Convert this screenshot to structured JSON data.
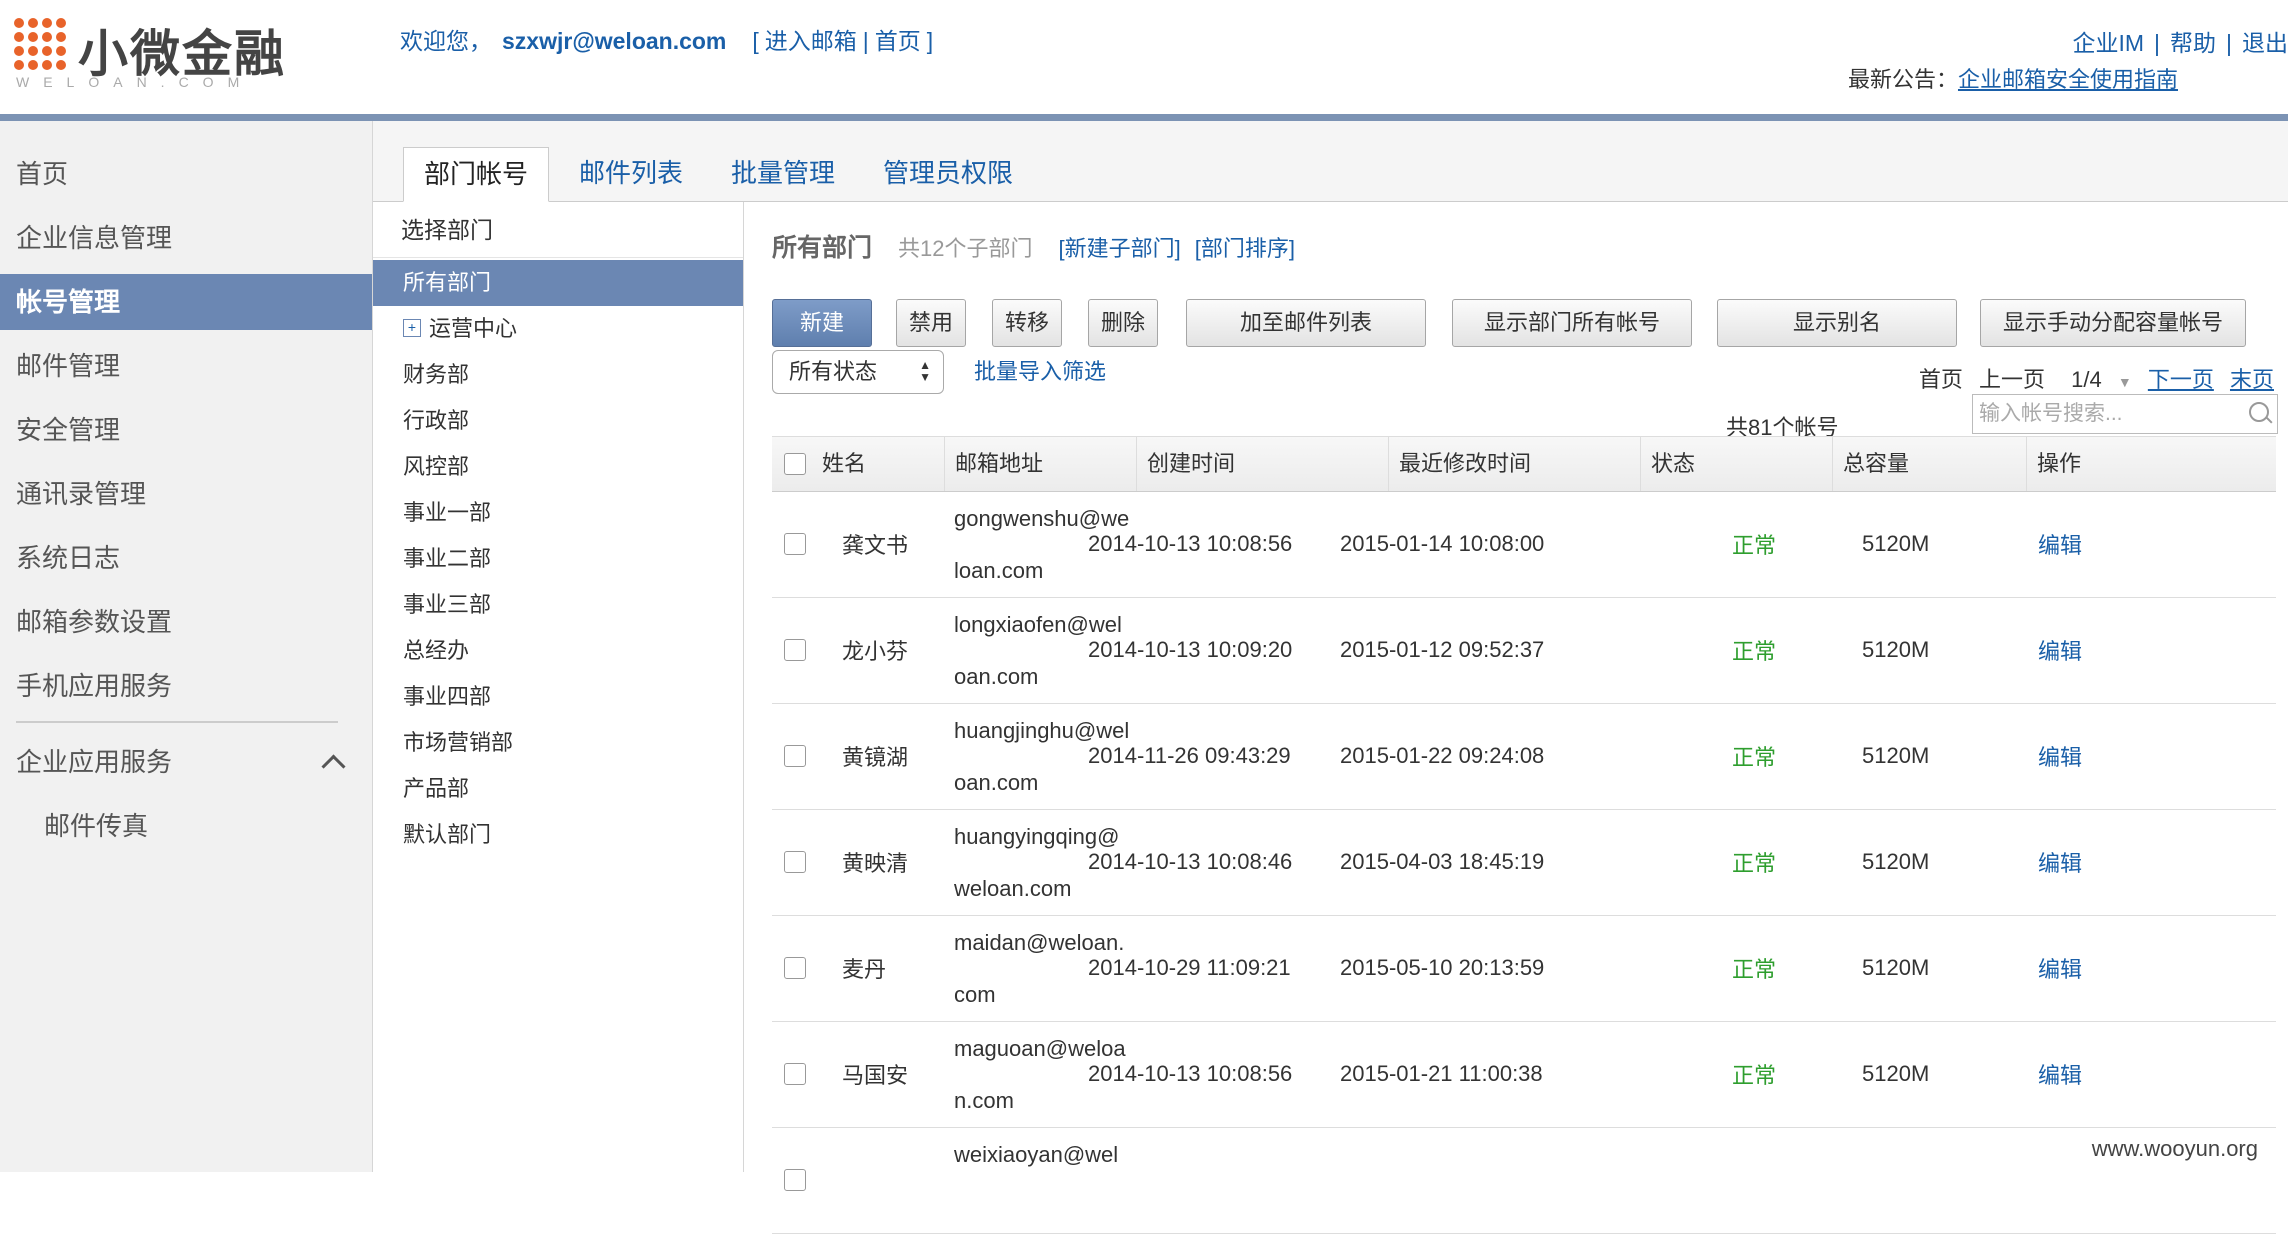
{
  "header": {
    "logo_text": "小微金融",
    "logo_sub": "WELOAN.COM",
    "welcome_prefix": "欢迎您，",
    "user_email": "szxwjr@weloan.com",
    "link_mailbox": "进入邮箱",
    "link_home": "首页",
    "top_links": {
      "im": "企业IM",
      "help": "帮助",
      "logout": "退出"
    },
    "notice_label": "最新公告：",
    "notice_link": "企业邮箱安全使用指南"
  },
  "sidebar": {
    "items": [
      {
        "label": "首页"
      },
      {
        "label": "企业信息管理"
      },
      {
        "label": "帐号管理"
      },
      {
        "label": "邮件管理"
      },
      {
        "label": "安全管理"
      },
      {
        "label": "通讯录管理"
      },
      {
        "label": "系统日志"
      },
      {
        "label": "邮箱参数设置"
      },
      {
        "label": "手机应用服务"
      }
    ],
    "group_label": "企业应用服务",
    "sub_items": [
      {
        "label": "邮件传真"
      }
    ]
  },
  "tabs": [
    {
      "label": "部门帐号"
    },
    {
      "label": "邮件列表"
    },
    {
      "label": "批量管理"
    },
    {
      "label": "管理员权限"
    }
  ],
  "departments": {
    "header": "选择部门",
    "items": [
      {
        "label": "所有部门"
      },
      {
        "label": "运营中心"
      },
      {
        "label": "财务部"
      },
      {
        "label": "行政部"
      },
      {
        "label": "风控部"
      },
      {
        "label": "事业一部"
      },
      {
        "label": "事业二部"
      },
      {
        "label": "事业三部"
      },
      {
        "label": "总经办"
      },
      {
        "label": "事业四部"
      },
      {
        "label": "市场营销部"
      },
      {
        "label": "产品部"
      },
      {
        "label": "默认部门"
      }
    ]
  },
  "main": {
    "title": "所有部门",
    "sub_count": "共12个子部门",
    "link_new_sub": "[新建子部门]",
    "link_sort": "[部门排序]",
    "buttons": {
      "new": "新建",
      "disable": "禁用",
      "move": "转移",
      "delete": "删除",
      "add_to_list": "加至邮件列表",
      "show_all": "显示部门所有帐号",
      "show_alias": "显示别名",
      "show_manual": "显示手动分配容量帐号"
    },
    "status_select": "所有状态",
    "import_filter": "批量导入筛选",
    "pager": {
      "first": "首页",
      "prev": "上一页",
      "page": "1/4",
      "next": "下一页",
      "last": "末页"
    },
    "search_placeholder": "输入帐号搜索...",
    "total": "共81个帐号"
  },
  "table": {
    "columns": [
      "姓名",
      "邮箱地址",
      "创建时间",
      "最近修改时间",
      "状态",
      "总容量",
      "操作"
    ],
    "rows": [
      {
        "name": "龚文书",
        "email": "gongwenshu@weloan.com",
        "created": "2014-10-13 10:08:56",
        "modified": "2015-01-14 10:08:00",
        "status": "正常",
        "quota": "5120M",
        "op": "编辑"
      },
      {
        "name": "龙小芬",
        "email": "longxiaofen@weloan.com",
        "created": "2014-10-13 10:09:20",
        "modified": "2015-01-12 09:52:37",
        "status": "正常",
        "quota": "5120M",
        "op": "编辑"
      },
      {
        "name": "黄镜湖",
        "email": "huangjinghu@weloan.com",
        "created": "2014-11-26 09:43:29",
        "modified": "2015-01-22 09:24:08",
        "status": "正常",
        "quota": "5120M",
        "op": "编辑"
      },
      {
        "name": "黄映清",
        "email": "huangyingqing@weloan.com",
        "created": "2014-10-13 10:08:46",
        "modified": "2015-04-03 18:45:19",
        "status": "正常",
        "quota": "5120M",
        "op": "编辑"
      },
      {
        "name": "麦丹",
        "email": "maidan@weloan.com",
        "created": "2014-10-29 11:09:21",
        "modified": "2015-05-10 20:13:59",
        "status": "正常",
        "quota": "5120M",
        "op": "编辑"
      },
      {
        "name": "马国安",
        "email": "maguoan@weloan.com",
        "created": "2014-10-13 10:08:56",
        "modified": "2015-01-21 11:00:38",
        "status": "正常",
        "quota": "5120M",
        "op": "编辑"
      },
      {
        "name": "",
        "email": "weixiaoyan@wel",
        "created": "",
        "modified": "",
        "status": "",
        "quota": "",
        "op": ""
      }
    ]
  },
  "watermark": "www.wooyun.org",
  "colors": {
    "accent": "#6b87b3",
    "link": "#1a5fa8",
    "status_ok": "#2e9e2e",
    "brand_orange": "#e8632a"
  }
}
